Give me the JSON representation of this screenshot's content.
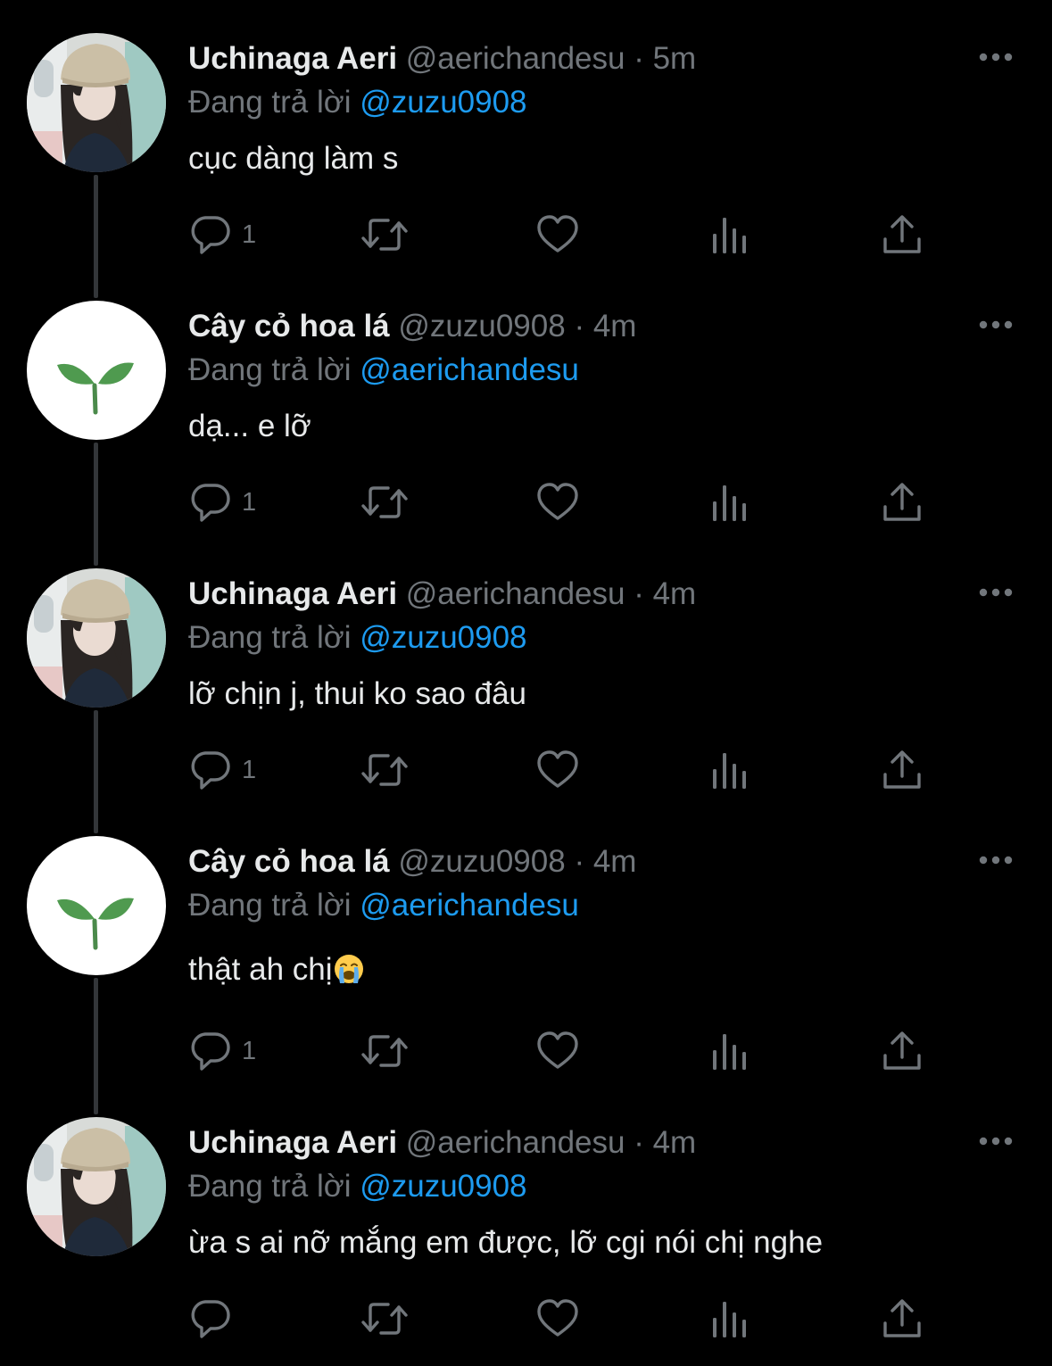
{
  "colors": {
    "background": "#000000",
    "text_primary": "#e7e9ea",
    "text_secondary": "#71767b",
    "mention": "#1d9bf0",
    "thread_line": "#333639"
  },
  "icons": {
    "reply": "speech-bubble-icon",
    "retweet": "retweet-arrows-icon",
    "like": "heart-outline-icon",
    "views": "bar-chart-icon",
    "share": "share-upload-icon",
    "more": "three-dots-icon"
  },
  "tweets": [
    {
      "avatar": "photo-girl-knit-hat",
      "display_name": "Uchinaga Aeri",
      "handle": "@aerichandesu",
      "separator": "·",
      "time": "5m",
      "reply_prefix": "Đang trả lời",
      "reply_to": "@zuzu0908",
      "text": "cục dàng làm s",
      "reply_count": "1"
    },
    {
      "avatar": "green-sprout",
      "display_name": "Cây cỏ hoa lá",
      "handle": "@zuzu0908",
      "separator": "·",
      "time": "4m",
      "reply_prefix": "Đang trả lời",
      "reply_to": "@aerichandesu",
      "text": "dạ... e lỡ",
      "reply_count": "1"
    },
    {
      "avatar": "photo-girl-knit-hat",
      "display_name": "Uchinaga Aeri",
      "handle": "@aerichandesu",
      "separator": "·",
      "time": "4m",
      "reply_prefix": "Đang trả lời",
      "reply_to": "@zuzu0908",
      "text": "lỡ chịn j, thui ko sao đâu",
      "reply_count": "1"
    },
    {
      "avatar": "green-sprout",
      "display_name": "Cây cỏ hoa lá",
      "handle": "@zuzu0908",
      "separator": "·",
      "time": "4m",
      "reply_prefix": "Đang trả lời",
      "reply_to": "@aerichandesu",
      "text": "thật ah chị",
      "text_emoji": "loudly-crying-face-emoji",
      "reply_count": "1"
    },
    {
      "avatar": "photo-girl-knit-hat",
      "display_name": "Uchinaga Aeri",
      "handle": "@aerichandesu",
      "separator": "·",
      "time": "4m",
      "reply_prefix": "Đang trả lời",
      "reply_to": "@zuzu0908",
      "text": "ừa s ai nỡ mắng em được, lỡ cgi nói chị nghe",
      "reply_count": ""
    }
  ]
}
